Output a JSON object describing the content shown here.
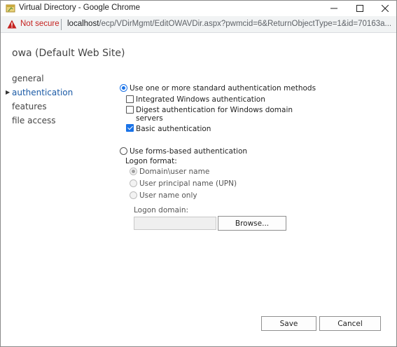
{
  "window": {
    "title": "Virtual Directory - Google Chrome",
    "address": {
      "security_label": "Not secure",
      "host": "localhost",
      "path": "/ecp/VDirMgmt/EditOWAVDir.aspx?pwmcid=6&ReturnObjectType=1&id=70163a..."
    }
  },
  "page": {
    "title": "owa (Default Web Site)"
  },
  "nav": {
    "items": [
      {
        "label": "general",
        "active": false
      },
      {
        "label": "authentication",
        "active": true
      },
      {
        "label": "features",
        "active": false
      },
      {
        "label": "file access",
        "active": false
      }
    ]
  },
  "auth": {
    "standard_option": "Use one or more standard authentication methods",
    "standard_selected": true,
    "methods": [
      {
        "label": "Integrated Windows authentication",
        "checked": false
      },
      {
        "label": "Digest authentication for Windows domain",
        "label2": "servers",
        "checked": false
      },
      {
        "label": "Basic authentication",
        "checked": true
      }
    ],
    "forms_option": "Use forms-based authentication",
    "forms_selected": false,
    "logon_format_label": "Logon format:",
    "logon_formats": [
      {
        "label": "Domain\\user name",
        "selected": true
      },
      {
        "label": "User principal name (UPN)",
        "selected": false
      },
      {
        "label": "User name only",
        "selected": false
      }
    ],
    "logon_domain_label": "Logon domain:",
    "logon_domain_value": "",
    "browse_label": "Browse..."
  },
  "footer": {
    "save_label": "Save",
    "cancel_label": "Cancel"
  },
  "colors": {
    "accent": "#1a73e8",
    "nav_active": "#1a5aa6",
    "warning": "#c5221f"
  }
}
